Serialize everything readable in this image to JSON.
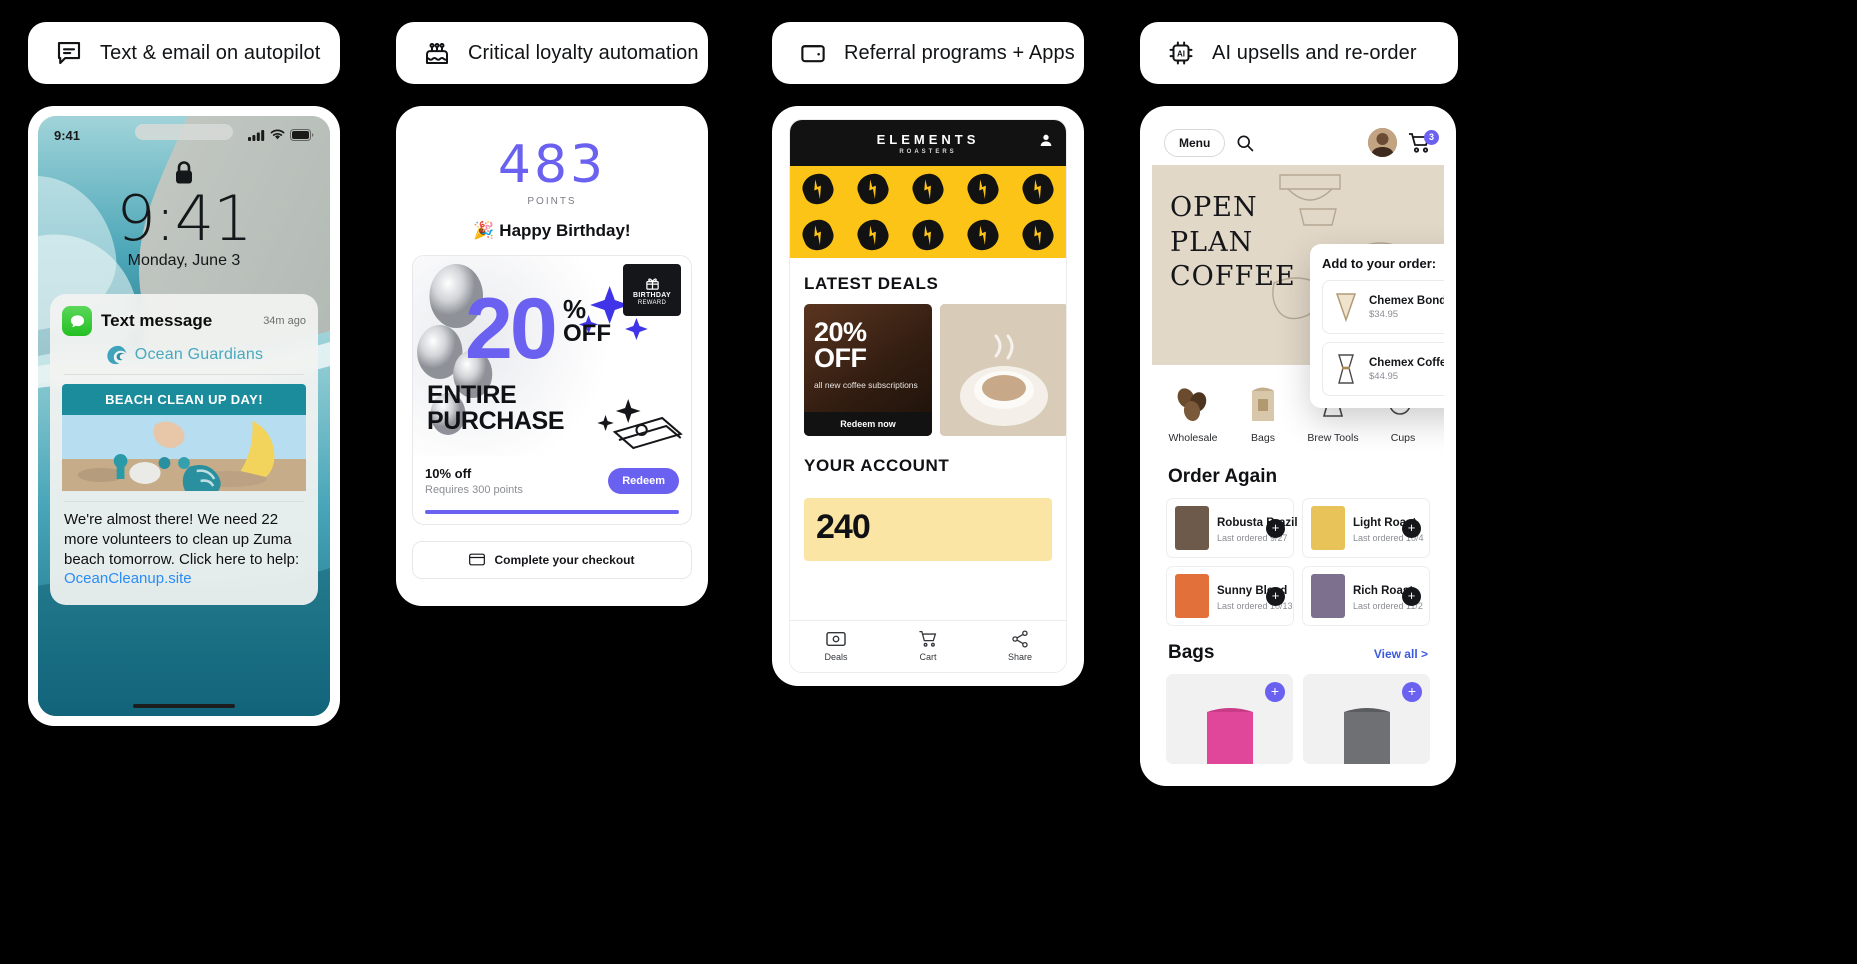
{
  "pills": [
    {
      "label": "Text & email on autopilot",
      "icon": "chat-bubble-icon"
    },
    {
      "label": "Critical loyalty automation",
      "icon": "birthday-cake-icon"
    },
    {
      "label": "Referral programs + Apps",
      "icon": "wallet-icon"
    },
    {
      "label": "AI upsells and re-order",
      "icon": "ai-chip-icon"
    }
  ],
  "phone1": {
    "status_time": "9:41",
    "lock_time": "9:41",
    "lock_date": "Monday, June 3",
    "notification": {
      "title": "Text message",
      "time": "34m ago",
      "brand": "Ocean Guardians",
      "banner": "BEACH CLEAN UP DAY!",
      "body_prefix": "We're almost there! We need 22 more volunteers to clean up Zuma beach tomorrow. Click here to help: ",
      "link": "OceanCleanup.site"
    }
  },
  "phone2": {
    "points": "483",
    "points_label": "POINTS",
    "birthday": "🎉 Happy Birthday!",
    "offer": {
      "number": "20",
      "percent": "%",
      "off": "OFF",
      "entire": "ENTIRE",
      "purchase": "PURCHASE",
      "badge_line1": "BIRTHDAY",
      "badge_line2": "REWARD",
      "discount_label": "10% off",
      "requirement": "Requires 300 points",
      "redeem_label": "Redeem"
    },
    "checkout_label": "Complete your checkout"
  },
  "phone3": {
    "logo": "ELEMENTS",
    "logo_sub": "ROASTERS",
    "deals_title": "LATEST DEALS",
    "deal": {
      "headline_1": "20%",
      "headline_2": "OFF",
      "subtext": "all new coffee subscriptions",
      "button": "Redeem now"
    },
    "account_title": "YOUR ACCOUNT",
    "account_points": "240",
    "tabs": [
      {
        "label": "Deals",
        "icon": "ticket-icon"
      },
      {
        "label": "Cart",
        "icon": "cart-icon"
      },
      {
        "label": "Share",
        "icon": "share-icon"
      }
    ]
  },
  "phone4": {
    "menu_label": "Menu",
    "cart_count": "3",
    "hero_title": "OPEN\nPLAN\nCOFFEE",
    "categories": [
      {
        "label": "Wholesale",
        "icon": "coffee-beans-icon"
      },
      {
        "label": "Bags",
        "icon": "coffee-bag-icon"
      },
      {
        "label": "Brew Tools",
        "icon": "chemex-icon"
      },
      {
        "label": "Cups",
        "icon": "cup-icon"
      }
    ],
    "upsell": {
      "title": "Add to your order:",
      "items": [
        {
          "name": "Chemex Bonded Filter",
          "price": "$34.95"
        },
        {
          "name": "Chemex Coffeemaker",
          "price": "$44.95"
        }
      ]
    },
    "order_again": {
      "title": "Order Again",
      "items": [
        {
          "name": "Robusta Brazil",
          "date": "Last ordered 9/27",
          "color": "#6e5a4a"
        },
        {
          "name": "Light Roast",
          "date": "Last ordered 10/4",
          "color": "#e8c35a"
        },
        {
          "name": "Sunny Blend",
          "date": "Last ordered 10/13",
          "color": "#e2703a"
        },
        {
          "name": "Rich Roast",
          "date": "Last ordered 11/2",
          "color": "#7d6f8e"
        }
      ]
    },
    "bags": {
      "title": "Bags",
      "view_all": "View all >",
      "items": [
        {
          "color": "#e0479a"
        },
        {
          "color": "#6e7073"
        }
      ]
    }
  },
  "colors": {
    "accent_purple": "#6b61f0",
    "brand_yellow": "#fcc417",
    "brand_teal": "#1a8c9c",
    "link_blue": "#3b5bdb"
  }
}
